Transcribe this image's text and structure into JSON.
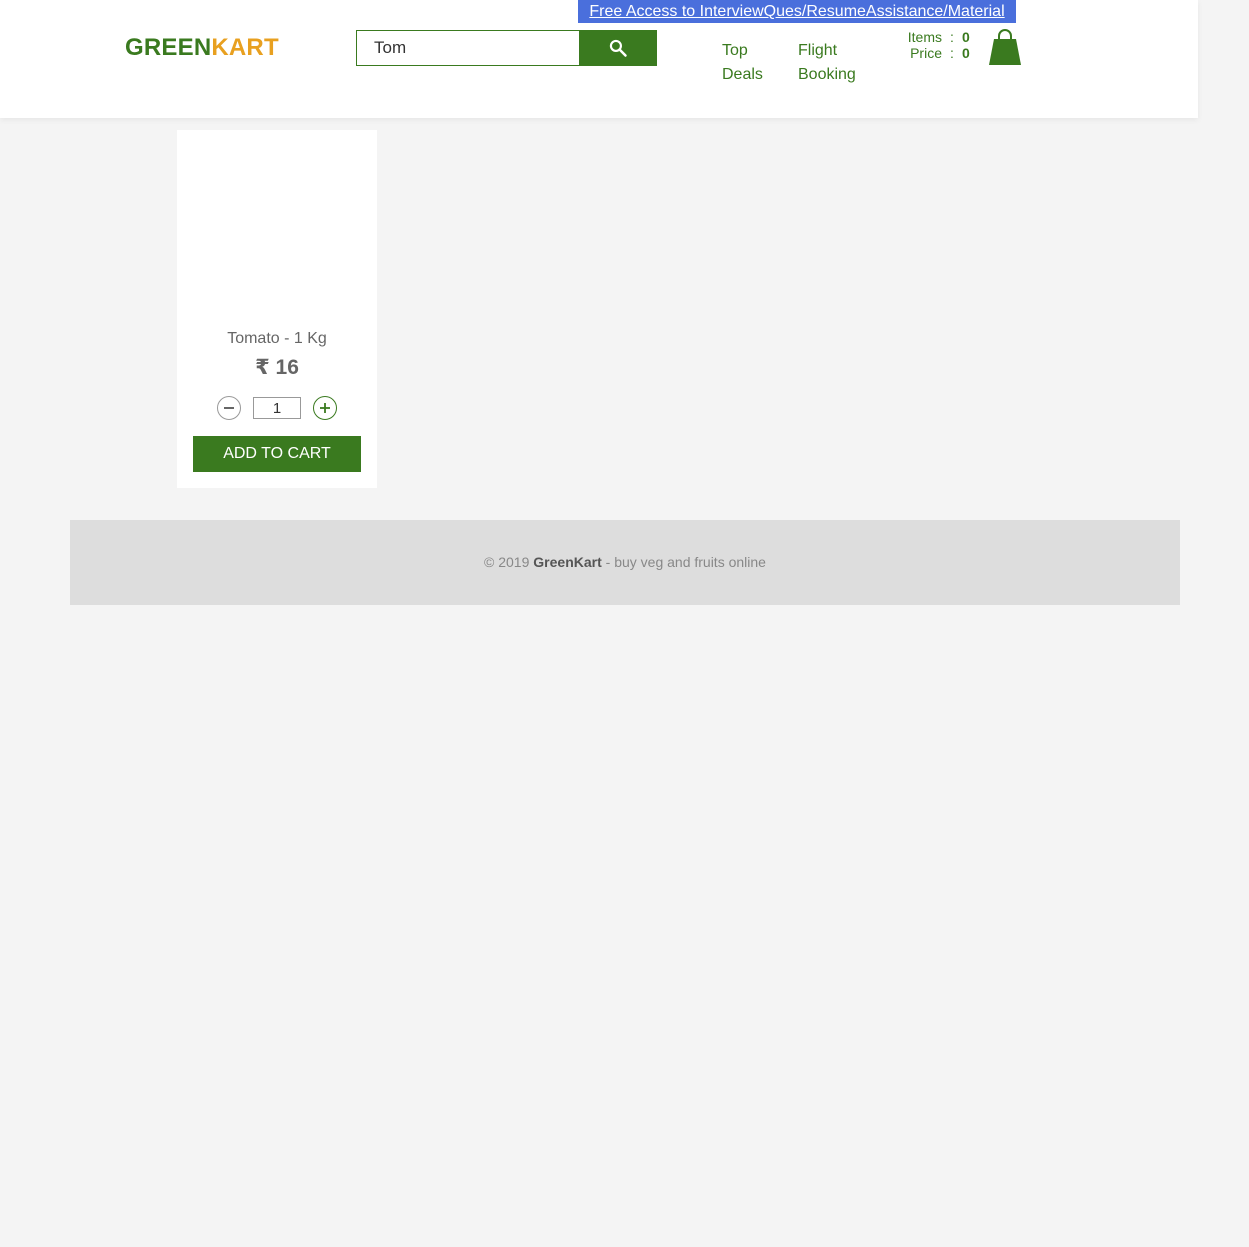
{
  "promo": {
    "text": "Free Access to InterviewQues/ResumeAssistance/Material"
  },
  "logo": {
    "part1": "GREEN",
    "part2": "KART"
  },
  "search": {
    "value": "Tom",
    "button_icon": "search-icon"
  },
  "nav": {
    "top_deals_label": "Top Deals",
    "flight_booking_label": "Flight Booking"
  },
  "cart": {
    "items_label": "Items",
    "items_value": "0",
    "price_label": "Price",
    "price_value": "0",
    "separator": ":",
    "icon": "shopping-bag-icon"
  },
  "product": {
    "name": "Tomato - 1 Kg",
    "price": "₹ 16",
    "quantity": "1",
    "decrement_symbol": "−",
    "increment_symbol": "+",
    "add_to_cart_label": "ADD TO CART"
  },
  "footer": {
    "prefix": "© 2019 ",
    "brand": "GreenKart",
    "suffix": " - buy veg and fruits online"
  },
  "colors": {
    "primary_green": "#3a7a1f",
    "logo_orange": "#e8a020",
    "promo_blue": "#4a6fdc",
    "background": "#f4f4f4",
    "footer_bg": "#dddddd"
  }
}
